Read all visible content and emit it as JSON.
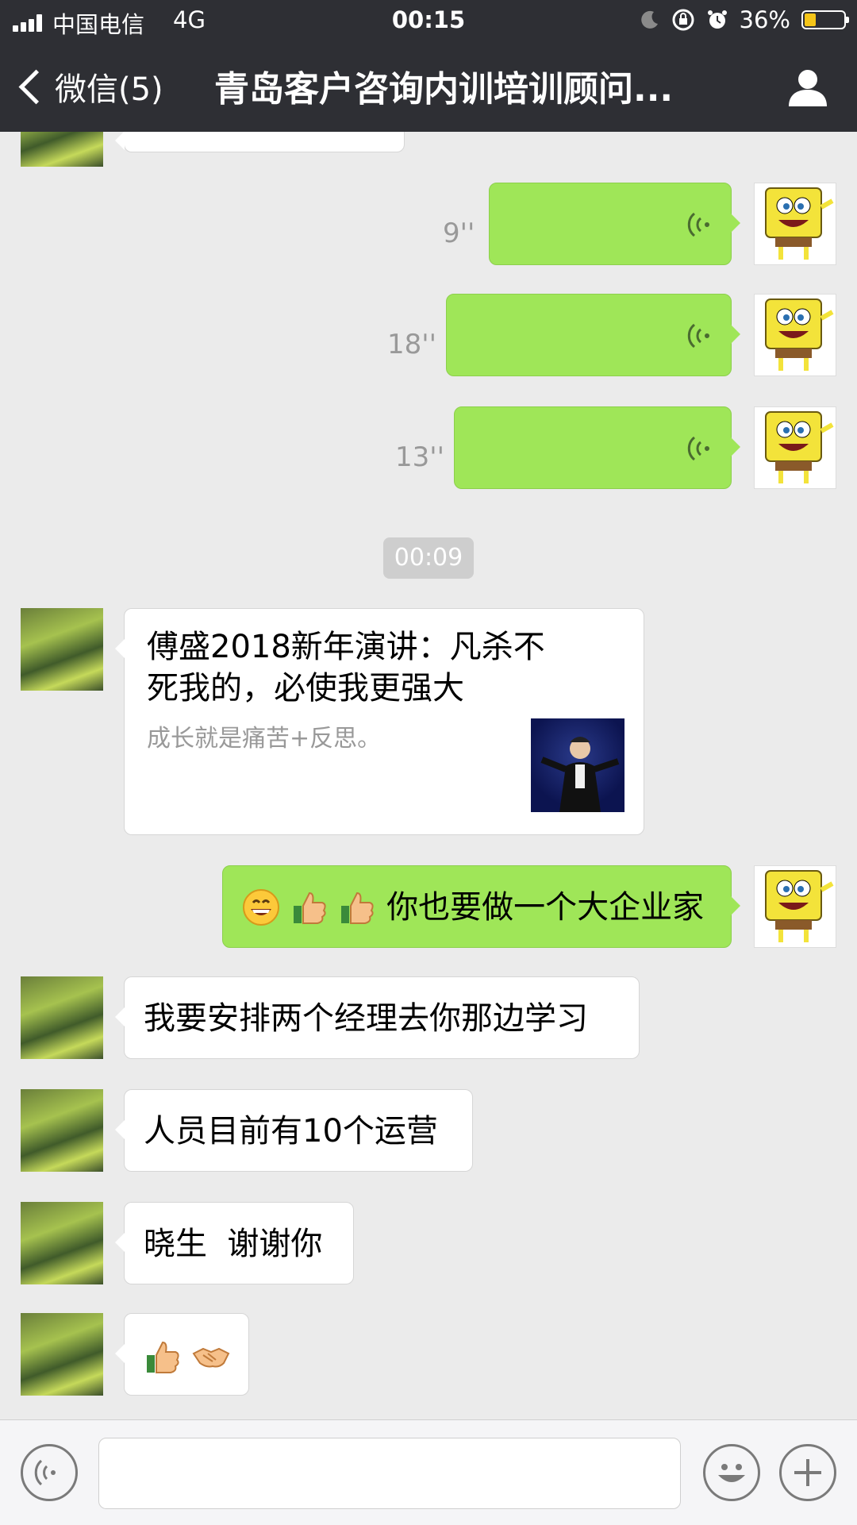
{
  "status_bar": {
    "carrier": "中国电信",
    "network": "4G",
    "time": "00:15",
    "battery": "36%"
  },
  "nav": {
    "back_label": "微信(5)",
    "title": "青岛客户咨询内训培训顾问..."
  },
  "messages": [
    {
      "type": "voice",
      "sender": "me",
      "duration": "9''"
    },
    {
      "type": "voice",
      "sender": "me",
      "duration": "18''"
    },
    {
      "type": "voice",
      "sender": "me",
      "duration": "13''"
    },
    {
      "type": "time",
      "text": "00:09"
    },
    {
      "type": "link_card",
      "sender": "other",
      "title": "傅盛2018新年演讲：凡杀不死我的，必使我更强大",
      "description": "成长就是痛苦+反思。"
    },
    {
      "type": "text",
      "sender": "me",
      "text": "你也要做一个大企业家",
      "emojis": [
        "grinning-face",
        "thumbs-up",
        "thumbs-up"
      ]
    },
    {
      "type": "text",
      "sender": "other",
      "text": "我要安排两个经理去你那边学习"
    },
    {
      "type": "text",
      "sender": "other",
      "text": "人员目前有10个运营"
    },
    {
      "type": "text",
      "sender": "other",
      "text": "晓生  谢谢你"
    },
    {
      "type": "emoji",
      "sender": "other",
      "emojis": [
        "thumbs-up",
        "handshake"
      ]
    }
  ],
  "input_bar": {
    "voice_icon": "voice-mode-icon",
    "emoji_icon": "emoji-icon",
    "plus_icon": "plus-icon"
  },
  "colors": {
    "header_bg": "#2e2f34",
    "chat_bg": "#ebebeb",
    "sent_bubble": "#9fe658",
    "received_bubble": "#ffffff"
  }
}
